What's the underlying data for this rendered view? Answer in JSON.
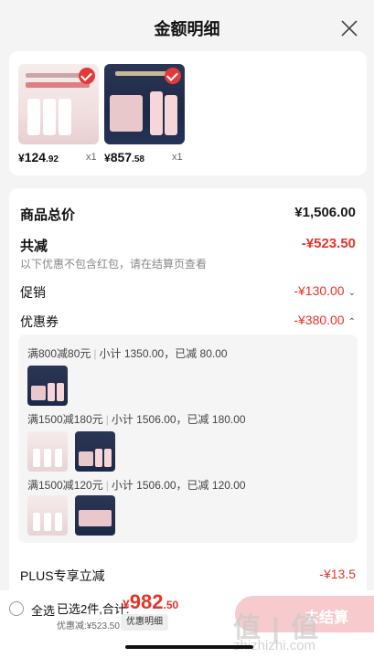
{
  "header": {
    "title": "金额明细"
  },
  "products": [
    {
      "price_yen": "¥",
      "price_int": "124",
      "price_dec": ".92",
      "qty": "x1"
    },
    {
      "price_yen": "¥",
      "price_int": "857",
      "price_dec": ".58",
      "qty": "x1"
    }
  ],
  "summary": {
    "total_label": "商品总价",
    "total_value": "¥1,506.00",
    "reduce_label": "共减",
    "reduce_value": "-¥523.50",
    "reduce_note": "以下优惠不包含红包，请在结算页查看",
    "promo_label": "促销",
    "promo_value": "-¥130.00",
    "coupon_label": "优惠券",
    "coupon_value": "-¥380.00",
    "plus_label": "PLUS专享立减",
    "plus_value": "-¥13.5"
  },
  "coupons": [
    {
      "rule": "满800减80元",
      "detail": "小计 1350.00，已减 80.00"
    },
    {
      "rule": "满1500减180元",
      "detail": "小计 1506.00，已减 180.00"
    },
    {
      "rule": "满1500减120元",
      "detail": "小计 1506.00，已减 120.00"
    }
  ],
  "footer": {
    "select_all": "全选",
    "selected_text": "已选2件,合计:",
    "total_yen": "¥",
    "total_int": "982",
    "total_dec": ".50",
    "discount_text": "优惠减:¥523.50",
    "detail_button": "优惠明细",
    "checkout": "去结算",
    "watermark": "值 | 值",
    "watermark_sub": "zhizhizhi.com"
  },
  "colors": {
    "accent": "#e6332a",
    "background": "#f4f4f4"
  }
}
